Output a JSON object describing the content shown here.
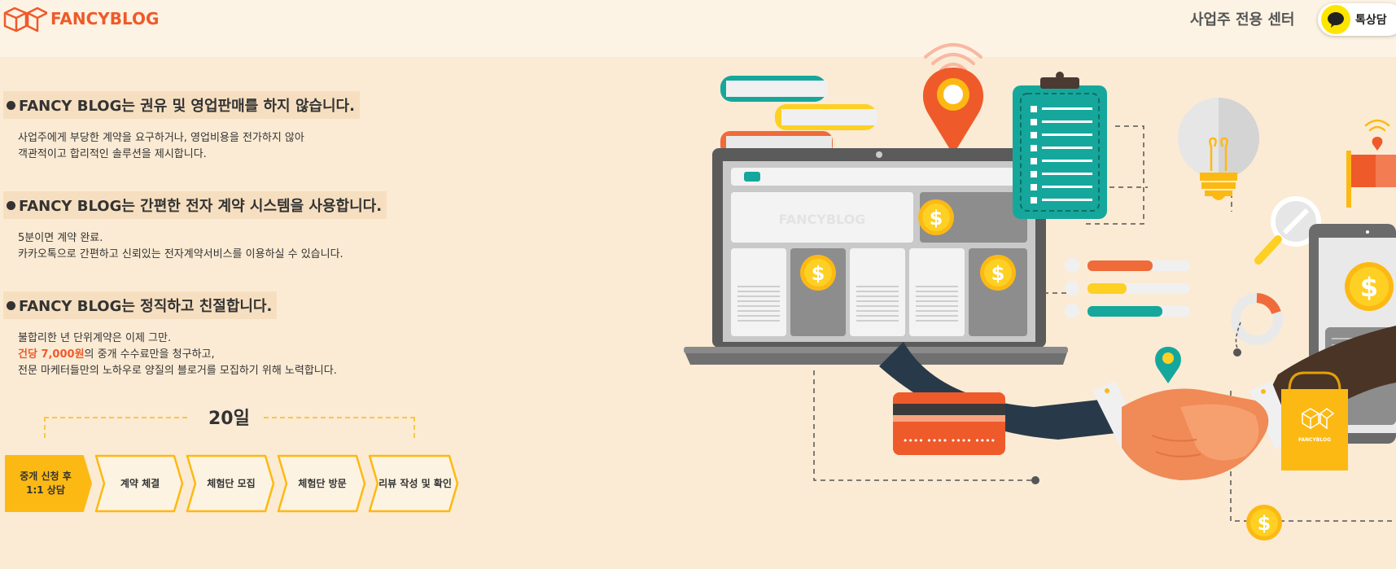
{
  "header": {
    "logo_text": "FANCYBLOG",
    "center_link": "사업주 전용 센터",
    "kakao_label": "톡상담"
  },
  "sections": [
    {
      "title": "FANCY BLOG는 권유 및 영업판매를 하지 않습니다.",
      "lines": [
        "사업주에게 부당한 계약을 요구하거나, 영업비용을 전가하지 않아",
        "객관적이고 합리적인 솔루션을 제시합니다."
      ]
    },
    {
      "title": "FANCY BLOG는 간편한 전자 계약 시스템을 사용합니다.",
      "lines": [
        "5분이면 계약 완료.",
        "카카오톡으로 간편하고 신뢰있는 전자계약서비스를 이용하실 수 있습니다."
      ]
    },
    {
      "title": "FANCY BLOG는 정직하고 친절합니다.",
      "line1": "불합리한 년 단위계약은 이제 그만.",
      "line2_highlight": "건당 7,000원",
      "line2_rest": "의 중개 수수료만을 청구하고,",
      "line3": "전문 마케터들만의 노하우로 양질의 블로거를 모집하기 위해 노력합니다."
    }
  ],
  "process": {
    "days": "20일",
    "steps": [
      {
        "line1": "중개 신청 후",
        "line2": "1:1 상담"
      },
      {
        "line1": "계약 체결",
        "line2": ""
      },
      {
        "line1": "체험단 모집",
        "line2": ""
      },
      {
        "line1": "체험단 방문",
        "line2": ""
      },
      {
        "line1": "리뷰 작성 및 확인",
        "line2": ""
      }
    ]
  },
  "illustration": {
    "screen_logo": "FANCYBLOG",
    "bag_logo": "FANCYBLOG",
    "coin_symbol": "$",
    "card_dots": "•••• •••• •••• ••••"
  },
  "colors": {
    "brand_orange": "#ef5a2a",
    "yellow": "#fdb913",
    "teal": "#16a79c",
    "background": "#fbebd4",
    "kakao_yellow": "#fde500"
  }
}
